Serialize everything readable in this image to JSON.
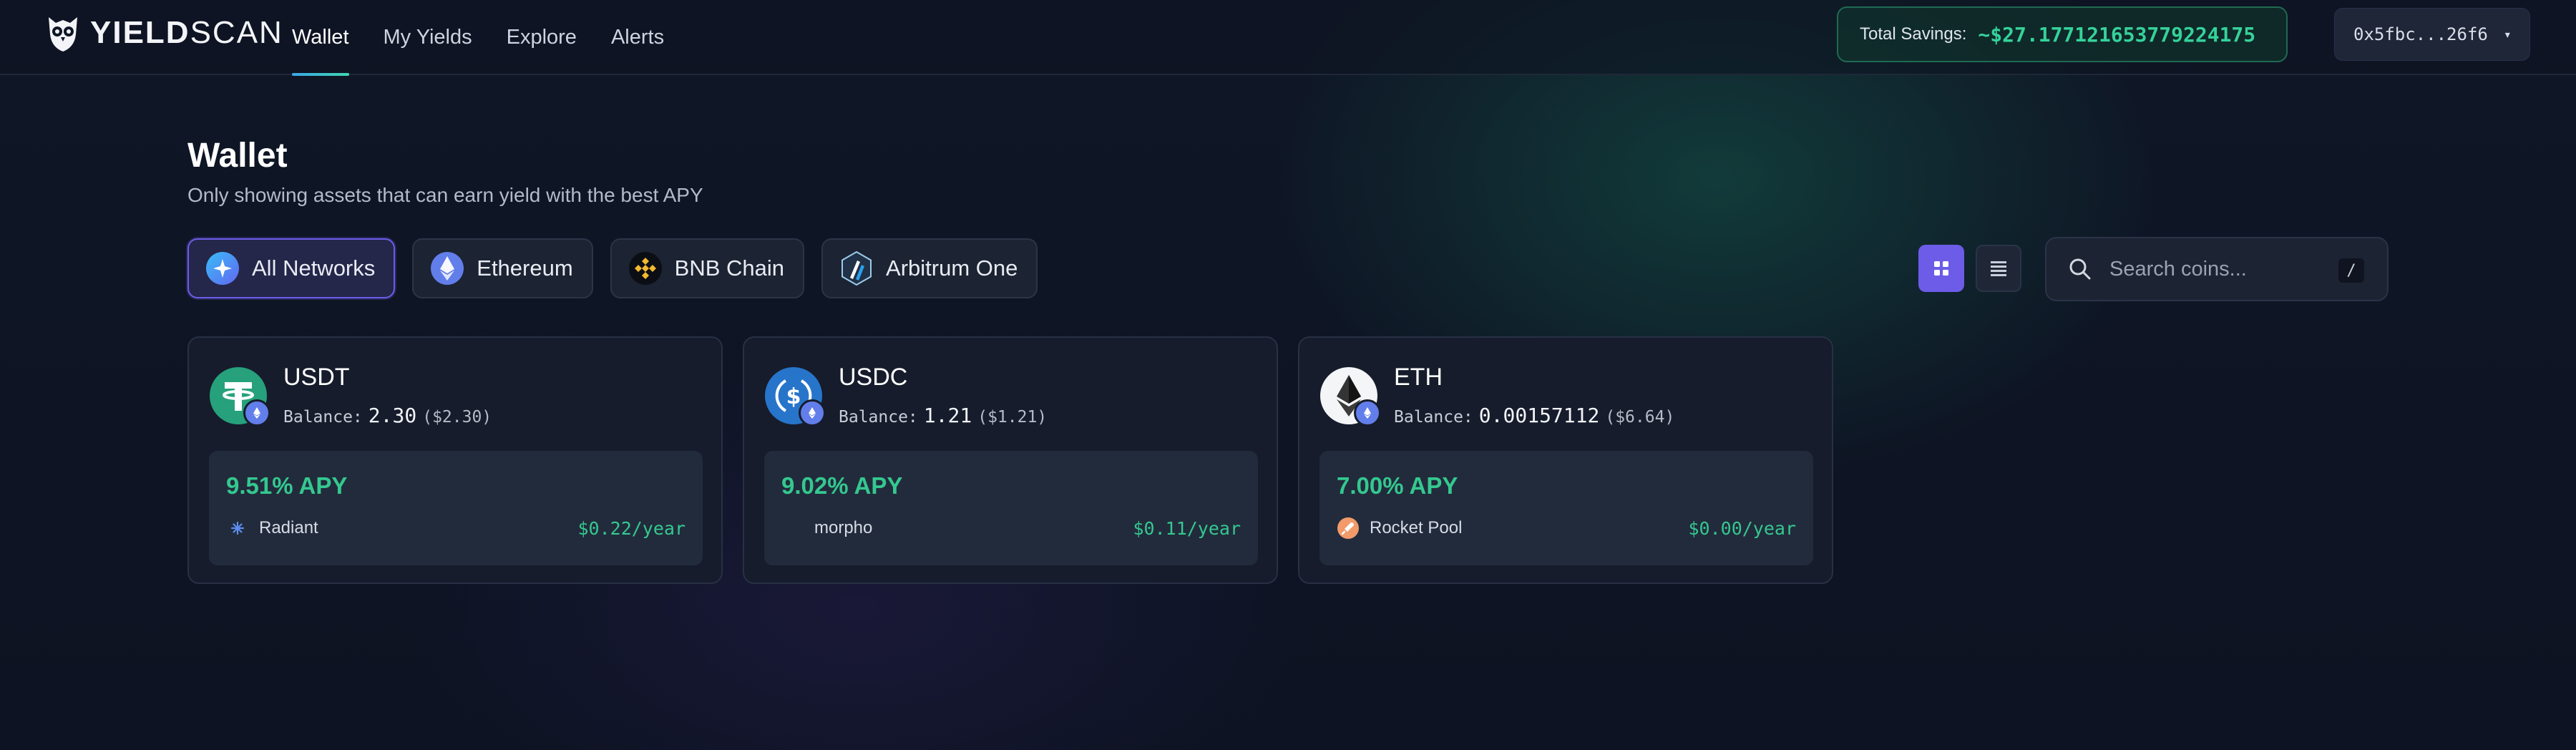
{
  "header": {
    "logo_bold": "YIELD",
    "logo_light": "SCAN",
    "nav": [
      {
        "label": "Wallet",
        "active": true
      },
      {
        "label": "My Yields",
        "active": false
      },
      {
        "label": "Explore",
        "active": false
      },
      {
        "label": "Alerts",
        "active": false
      }
    ],
    "savings_label": "Total Savings:",
    "savings_value": "~$27.177121653779224175",
    "wallet_address": "0x5fbc...26f6",
    "wallet_caret": "▾"
  },
  "page": {
    "title": "Wallet",
    "subtitle": "Only showing assets that can earn yield with the best APY"
  },
  "networks": [
    {
      "label": "All Networks",
      "icon": "all-networks-icon",
      "active": true
    },
    {
      "label": "Ethereum",
      "icon": "ethereum-icon",
      "active": false
    },
    {
      "label": "BNB Chain",
      "icon": "bnb-icon",
      "active": false
    },
    {
      "label": "Arbitrum One",
      "icon": "arbitrum-icon",
      "active": false
    }
  ],
  "view": {
    "selected": "grid"
  },
  "search": {
    "placeholder": "Search coins...",
    "shortcut": "/"
  },
  "colors": {
    "accent": "#6c5ce7",
    "positive": "#34c88f",
    "savings_border": "#1f6a52"
  },
  "cards": [
    {
      "symbol": "USDT",
      "balance_label": "Balance:",
      "balance_amount": "2.30",
      "balance_usd": "($2.30)",
      "apy": "9.51% APY",
      "protocol": "Radiant",
      "earnings": "$0.22/year",
      "icon": "usdt-icon",
      "chain_icon": "ethereum-icon"
    },
    {
      "symbol": "USDC",
      "balance_label": "Balance:",
      "balance_amount": "1.21",
      "balance_usd": "($1.21)",
      "apy": "9.02% APY",
      "protocol": "morpho",
      "earnings": "$0.11/year",
      "icon": "usdc-icon",
      "chain_icon": "ethereum-icon"
    },
    {
      "symbol": "ETH",
      "balance_label": "Balance:",
      "balance_amount": "0.00157112",
      "balance_usd": "($6.64)",
      "apy": "7.00% APY",
      "protocol": "Rocket Pool",
      "earnings": "$0.00/year",
      "icon": "eth-icon",
      "chain_icon": "ethereum-icon"
    }
  ]
}
